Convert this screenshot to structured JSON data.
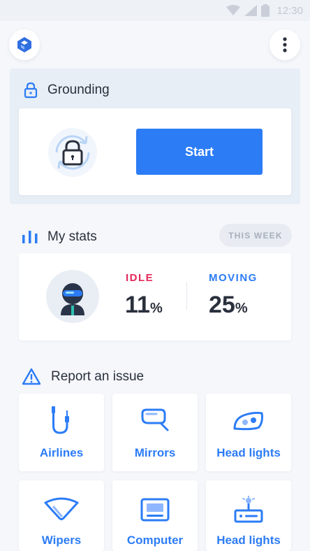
{
  "status_bar": {
    "time": "12:30",
    "icons": [
      "wifi-icon",
      "signal-icon",
      "battery-icon"
    ]
  },
  "header": {
    "logo_icon": "app-logo",
    "menu_icon": "more-vertical-icon"
  },
  "grounding": {
    "title": "Grounding",
    "icon": "lock-icon",
    "start_label": "Start"
  },
  "stats": {
    "title": "My stats",
    "icon": "bar-chart-icon",
    "period": "THIS WEEK",
    "idle": {
      "label": "IDLE",
      "value": "11",
      "unit": "%"
    },
    "moving": {
      "label": "MOVING",
      "value": "25",
      "unit": "%"
    }
  },
  "report": {
    "title": "Report an issue",
    "icon": "warning-icon",
    "items": [
      {
        "label": "Airlines",
        "icon": "airline-hose-icon"
      },
      {
        "label": "Mirrors",
        "icon": "mirror-icon"
      },
      {
        "label": "Head lights",
        "icon": "headlight-icon"
      },
      {
        "label": "Wipers",
        "icon": "wiper-icon"
      },
      {
        "label": "Computer",
        "icon": "computer-icon"
      },
      {
        "label": "Head lights",
        "icon": "warning-light-icon"
      }
    ]
  },
  "colors": {
    "accent": "#2c7cf6",
    "idle": "#e5285a",
    "moving": "#2c7cf6",
    "background": "#f5f7fb"
  }
}
